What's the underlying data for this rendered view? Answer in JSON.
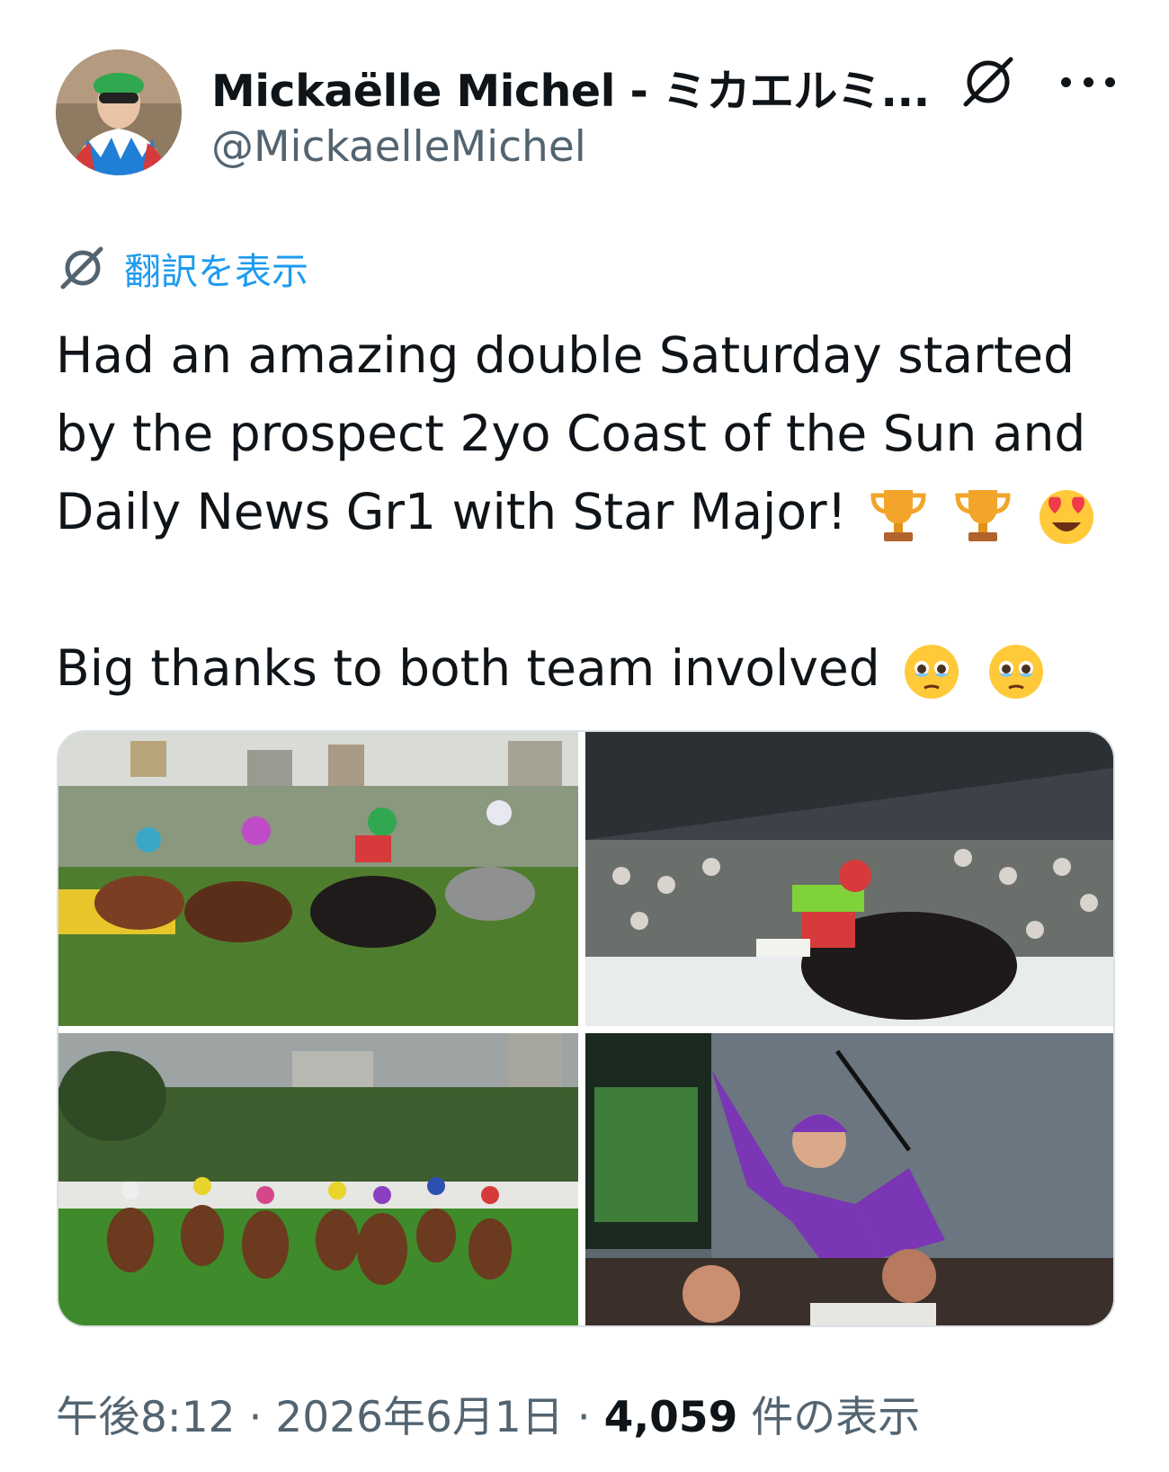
{
  "author": {
    "display_name": "Mickaëlle Michel - ミカエルミ...",
    "handle": "@MickaelleMichel",
    "avatar_icon": "jockey-avatar"
  },
  "header_icons": {
    "grok": "grok-icon",
    "more": "more-icon"
  },
  "translate": {
    "label": "翻訳を表示",
    "icon": "grok-translate-icon"
  },
  "tweet": {
    "line1": "Had an amazing double Saturday started",
    "line2": "by the prospect 2yo Coast of the Sun and",
    "line3": "Daily News Gr1 with Star Major!",
    "line4": "Big thanks to both team involved",
    "emojis_line3": [
      "trophy",
      "trophy",
      "heart-eyes"
    ],
    "emojis_line4": [
      "face-holding-back-tears",
      "face-holding-back-tears"
    ]
  },
  "media": {
    "photos": [
      {
        "description_icon": "horse-race-photo"
      },
      {
        "description_icon": "winner-horse-photo"
      },
      {
        "description_icon": "race-field-photo"
      },
      {
        "description_icon": "jockey-celebration-photo"
      }
    ]
  },
  "meta": {
    "time": "午後8:12",
    "sep1": " · ",
    "date": "2026年6月1日",
    "sep2": " · ",
    "views_count": "4,059",
    "views_label": " 件の表示"
  },
  "colors": {
    "link": "#1d9bf0",
    "secondary": "#536471",
    "text": "#0f1419"
  }
}
